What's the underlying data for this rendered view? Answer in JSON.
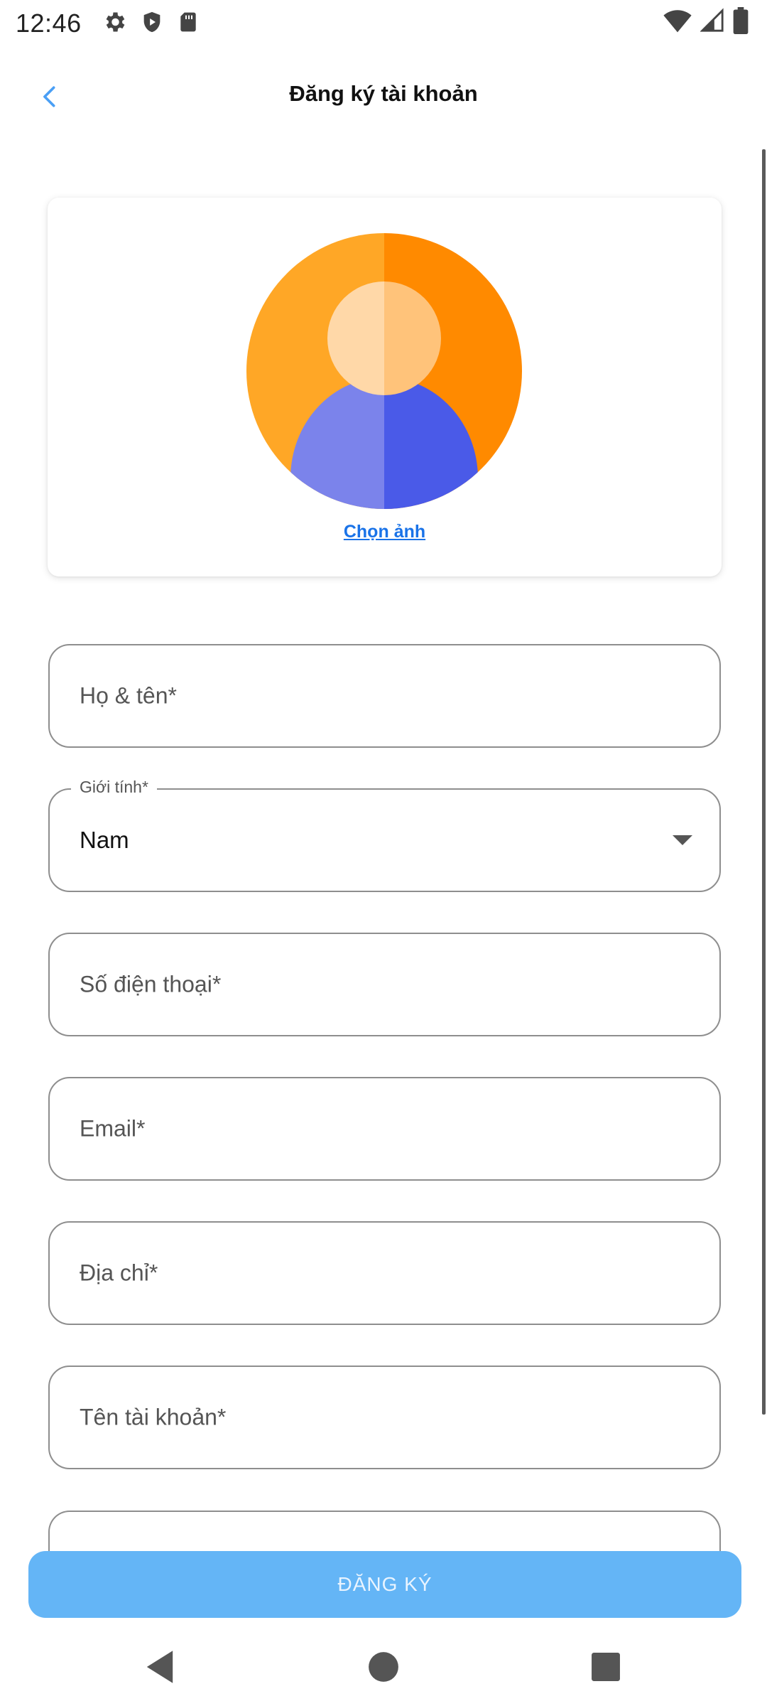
{
  "status_bar": {
    "time": "12:46",
    "icons_left": [
      "settings-icon",
      "shield-play-icon",
      "sd-card-icon"
    ],
    "icons_right": [
      "wifi-icon",
      "signal-icon",
      "battery-icon"
    ]
  },
  "app_bar": {
    "title": "Đăng ký tài khoản",
    "back_icon": "chevron-left-icon"
  },
  "avatar_card": {
    "choose_photo_label": "Chọn ảnh",
    "colors": {
      "bg_left": "#FFA726",
      "bg_right": "#FF8A00",
      "face_left": "#FFD8A8",
      "face_right": "#FFC37A",
      "body_left": "#7B83EB",
      "body_right": "#4A5AE8"
    }
  },
  "form": {
    "full_name": {
      "placeholder": "Họ & tên*"
    },
    "gender": {
      "label": "Giới tính*",
      "value": "Nam"
    },
    "phone": {
      "placeholder": "Số điện thoại*"
    },
    "email": {
      "placeholder": "Email*"
    },
    "address": {
      "placeholder": "Địa chỉ*"
    },
    "username": {
      "placeholder": "Tên tài khoản*"
    }
  },
  "register_button": {
    "label": "ĐĂNG KÝ",
    "color": "#64B5F6"
  },
  "nav_bar": {
    "icons": [
      "back-triangle-icon",
      "home-circle-icon",
      "recents-square-icon"
    ]
  }
}
